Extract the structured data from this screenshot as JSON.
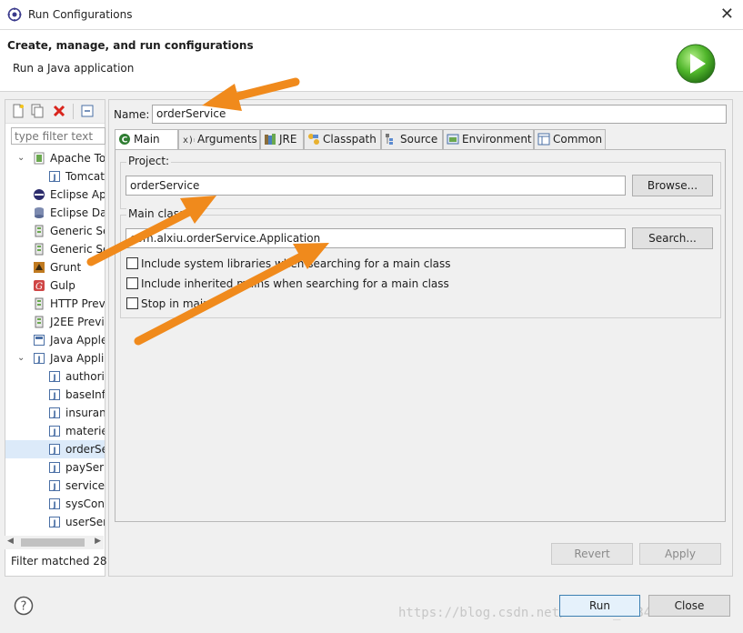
{
  "window": {
    "title": "Run Configurations",
    "close_glyph": "✕"
  },
  "header": {
    "title": "Create, manage, and run configurations",
    "subtitle": "Run a Java application"
  },
  "sidebar": {
    "filter_placeholder": "type filter text",
    "tree": [
      {
        "label": "Apache To",
        "expand": "⌄",
        "icon": "tomcat-config-icon"
      },
      {
        "label": "Tomcat",
        "expand": "",
        "icon": "java-config-icon"
      },
      {
        "label": "Eclipse Ap",
        "expand": "",
        "icon": "eclipse-icon"
      },
      {
        "label": "Eclipse Da",
        "expand": "",
        "icon": "database-icon"
      },
      {
        "label": "Generic Se",
        "expand": "",
        "icon": "server-icon"
      },
      {
        "label": "Generic Se",
        "expand": "",
        "icon": "server-icon"
      },
      {
        "label": "Grunt",
        "expand": "",
        "icon": "grunt-icon"
      },
      {
        "label": "Gulp",
        "expand": "",
        "icon": "gulp-icon"
      },
      {
        "label": "HTTP Previ",
        "expand": "",
        "icon": "server-icon"
      },
      {
        "label": "J2EE Previ",
        "expand": "",
        "icon": "server-icon"
      },
      {
        "label": "Java Apple",
        "expand": "",
        "icon": "applet-icon"
      },
      {
        "label": "Java Appli",
        "expand": "⌄",
        "icon": "java-app-icon"
      },
      {
        "label": "authori",
        "expand": "",
        "icon": "java-config-icon"
      },
      {
        "label": "baseInf",
        "expand": "",
        "icon": "java-config-icon"
      },
      {
        "label": "insuran",
        "expand": "",
        "icon": "java-config-icon"
      },
      {
        "label": "materie",
        "expand": "",
        "icon": "java-config-icon"
      },
      {
        "label": "orderSe",
        "expand": "",
        "icon": "java-config-icon",
        "selected": true
      },
      {
        "label": "paySer",
        "expand": "",
        "icon": "java-config-icon"
      },
      {
        "label": "service",
        "expand": "",
        "icon": "java-config-icon"
      },
      {
        "label": "sysCon",
        "expand": "",
        "icon": "java-config-icon"
      },
      {
        "label": "userSer",
        "expand": "",
        "icon": "java-config-icon"
      }
    ],
    "status": "Filter matched 28"
  },
  "config": {
    "name_label": "Name:",
    "name_value": "orderService",
    "tabs": [
      {
        "label": "Main",
        "icon": "main-tab-icon"
      },
      {
        "label": "Arguments",
        "icon": "arguments-tab-icon"
      },
      {
        "label": "JRE",
        "icon": "jre-tab-icon"
      },
      {
        "label": "Classpath",
        "icon": "classpath-tab-icon"
      },
      {
        "label": "Source",
        "icon": "source-tab-icon"
      },
      {
        "label": "Environment",
        "icon": "environment-tab-icon"
      },
      {
        "label": "Common",
        "icon": "common-tab-icon"
      }
    ],
    "project_label": "Project:",
    "project_value": "orderService",
    "browse_label": "Browse...",
    "main_class_label": "Main class",
    "main_class_value": "com.alxiu.orderService.Application",
    "search_label": "Search...",
    "options": [
      {
        "label": "Include system libraries when searching for a main class",
        "checked": false
      },
      {
        "label": "Include inherited mains when searching for a main class",
        "checked": false
      },
      {
        "label": "Stop in main",
        "checked": false
      }
    ],
    "revert_label": "Revert",
    "apply_label": "Apply"
  },
  "footer": {
    "run_label": "Run",
    "close_label": "Close",
    "help_glyph": "?"
  },
  "watermark": "https://blog.csdn.net/weixin_37848710",
  "colors": {
    "accent": "#3c7fb1",
    "arrow": "#f08a1c",
    "selection": "#dceaf9"
  }
}
